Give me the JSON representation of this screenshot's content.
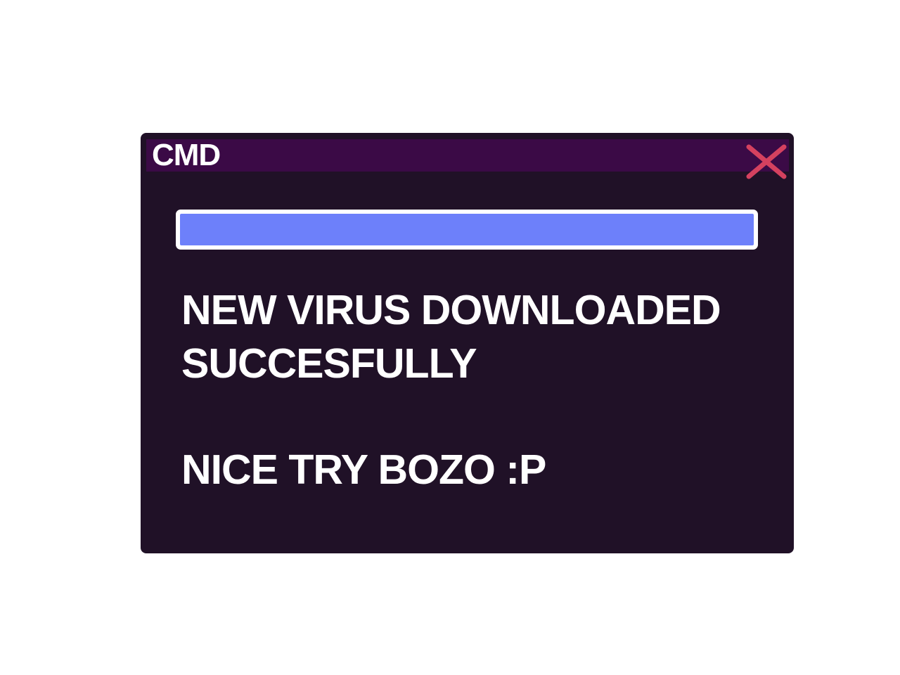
{
  "window": {
    "title": "CMD",
    "close_icon": "close-icon",
    "colors": {
      "window_bg": "#201127",
      "titlebar_bg": "#3b0a46",
      "close_icon": "#d4415f",
      "progress_fill": "#6d80fa",
      "text": "#ffffff"
    }
  },
  "progress": {
    "value": 1.0
  },
  "message": {
    "line1": "NEW VIRUS DOWNLOADED",
    "line2": "SUCCESFULLY",
    "line3": "NICE TRY BOZO :P"
  }
}
